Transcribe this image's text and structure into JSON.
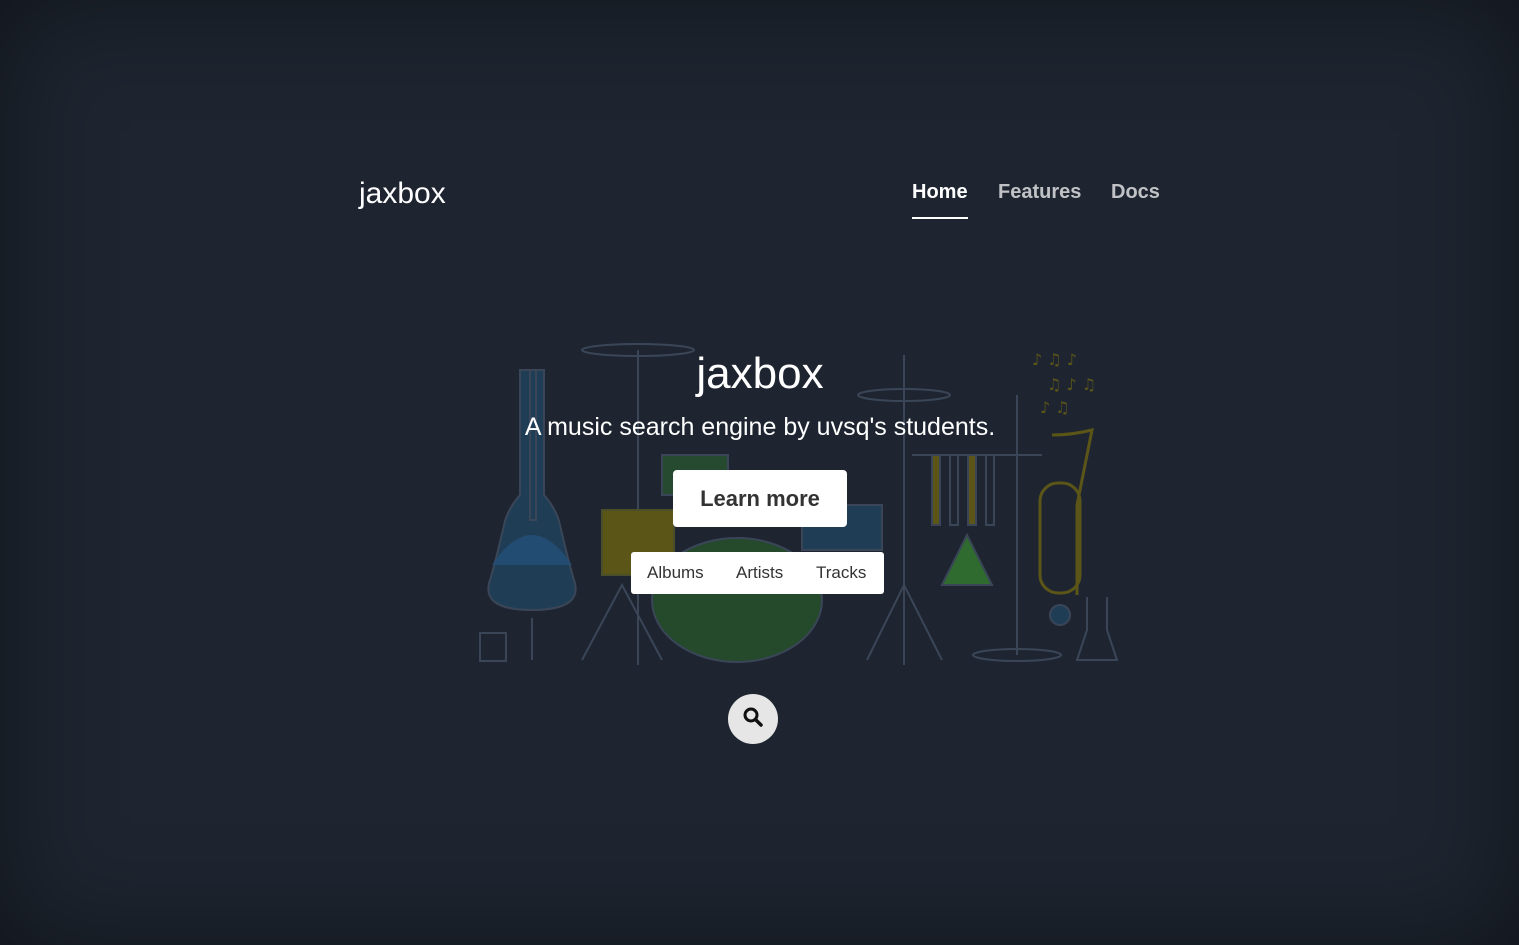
{
  "header": {
    "brand": "jaxbox",
    "nav": [
      {
        "label": "Home",
        "active": true
      },
      {
        "label": "Features",
        "active": false
      },
      {
        "label": "Docs",
        "active": false
      }
    ]
  },
  "hero": {
    "title": "jaxbox",
    "lead": "A music search engine by uvsq's students.",
    "cta": "Learn more",
    "tabs": [
      "Albums",
      "Artists",
      "Tracks"
    ],
    "search_icon": "search-icon"
  },
  "colors": {
    "background": "#1e2530",
    "text": "#ffffff",
    "button_bg": "#ffffff",
    "button_text": "#333333",
    "search_button_bg": "#e6e6e6",
    "illustration_blue": "#2c5f86",
    "illustration_yellow": "#7f7420",
    "illustration_green": "#2f6b2e"
  }
}
